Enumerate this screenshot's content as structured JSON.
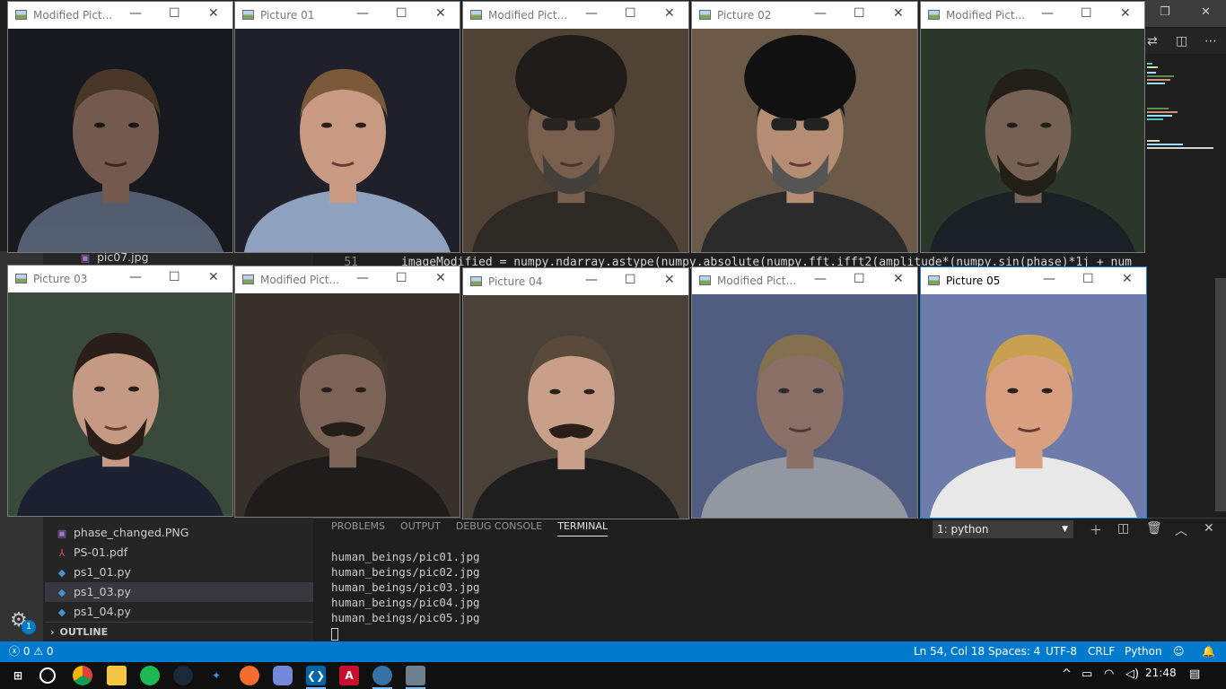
{
  "vscode": {
    "code": {
      "line_number": "51",
      "text": "imageModified = numpy.ndarray.astype(numpy.absolute(numpy.fft.ifft2(amplitude*(numpy.sin(phase)*1j + num"
    },
    "explorer": {
      "partial_top": "pic07.jpg",
      "files": [
        {
          "name": "phase_changed.PNG",
          "icon": "image-icon"
        },
        {
          "name": "PS-01.pdf",
          "icon": "pdf-icon"
        },
        {
          "name": "ps1_01.py",
          "icon": "python-icon"
        },
        {
          "name": "ps1_03.py",
          "icon": "python-icon",
          "selected": true
        },
        {
          "name": "ps1_04.py",
          "icon": "python-icon"
        }
      ],
      "outline_label": "OUTLINE",
      "settings_badge": "1"
    },
    "panel": {
      "tabs": [
        "PROBLEMS",
        "OUTPUT",
        "DEBUG CONSOLE",
        "TERMINAL"
      ],
      "active_tab": "TERMINAL",
      "terminal_select": "1: python",
      "terminal_lines": [
        "human_beings/pic01.jpg",
        "human_beings/pic02.jpg",
        "human_beings/pic03.jpg",
        "human_beings/pic04.jpg",
        "human_beings/pic05.jpg"
      ]
    },
    "statusbar": {
      "errors": "0",
      "warnings": "0",
      "position": "Ln 54, Col 18",
      "spaces": "Spaces: 4",
      "encoding": "UTF-8",
      "eol": "CRLF",
      "language": "Python"
    }
  },
  "windows": [
    {
      "title": "Modified Pict...",
      "scene": "man1"
    },
    {
      "title": "Picture 01",
      "scene": "man1"
    },
    {
      "title": "Modified Pict...",
      "scene": "cleric"
    },
    {
      "title": "Picture 02",
      "scene": "cleric"
    },
    {
      "title": "Modified Pict...",
      "scene": "bearded"
    },
    {
      "title": "Picture 03",
      "scene": "bearded"
    },
    {
      "title": "Modified Pict...",
      "scene": "mustache"
    },
    {
      "title": "Picture 04",
      "scene": "mustache"
    },
    {
      "title": "Modified Pict...",
      "scene": "blond"
    },
    {
      "title": "Picture 05",
      "scene": "blond",
      "active": true
    }
  ],
  "taskbar": {
    "time": "21:48",
    "apps": [
      "start",
      "cortana",
      "chrome",
      "explorer",
      "spotify",
      "steam",
      "code-app",
      "origin",
      "discord",
      "vscode",
      "acrobat",
      "python",
      "python-active"
    ]
  }
}
